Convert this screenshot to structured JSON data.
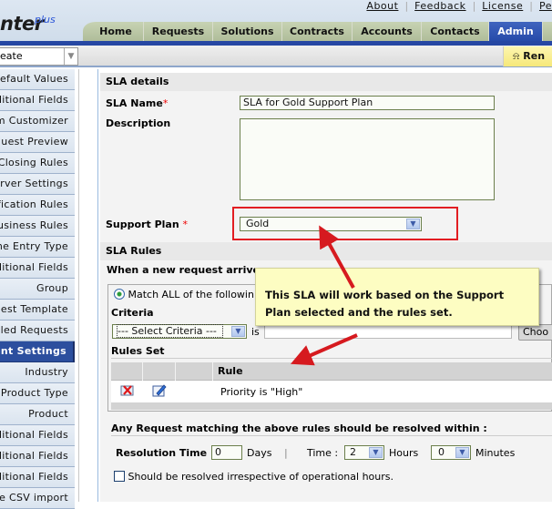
{
  "header": {
    "logo_text": "nter",
    "logo_suffix": "plus",
    "top_links": [
      "About",
      "Feedback",
      "License",
      "Pe"
    ],
    "tabs": [
      "Home",
      "Requests",
      "Solutions",
      "Contracts",
      "Accounts",
      "Contacts",
      "Admin"
    ],
    "active_tab": "Admin"
  },
  "subbar": {
    "quick_create_value": "eate",
    "reminder_label": "Ren"
  },
  "sidebar": {
    "items": [
      "Default Values",
      "Additional Fields",
      "Form Customizer",
      "Request Preview",
      "Closing Rules",
      "Server Settings",
      "Notification Rules",
      "Business Rules",
      "Time Entry Type",
      "Additional Fields",
      "Group",
      "Request Template",
      "Scheduled Requests",
      "Account Settings",
      "Industry",
      "Product Type",
      "Product",
      "Additional Fields",
      "Additional Fields",
      "Additional Fields",
      "Bulk CSV import"
    ],
    "visible_items": [
      "efault Values",
      "ditional Fields",
      "m Customizer",
      "quest Preview",
      "Closing Rules",
      "erver Settings",
      "fication Rules",
      "usiness Rules",
      "ne Entry Type",
      "ditional Fields",
      "Group",
      "est Template",
      "led Requests",
      "nt Settings",
      "Industry",
      "Product Type",
      "Product",
      "ditional Fields",
      "ditional Fields",
      "ditional Fields",
      "le CSV import"
    ],
    "active_index": 13
  },
  "form": {
    "sla_details_heading": "SLA details",
    "sla_name_label": "SLA Name",
    "sla_name_value": "SLA for Gold Support Plan",
    "description_label": "Description",
    "description_value": "",
    "support_plan_label": "Support Plan",
    "support_plan_value": "Gold",
    "required_mark": "*",
    "sla_rules_heading": "SLA Rules",
    "new_request_label": "When a new request arrives",
    "match_all_label": "Match ALL of the followin",
    "criteria_label": "Criteria",
    "criteria_select_value": "--- Select Criteria ---",
    "criteria_is": "is",
    "choose_button": "Choo",
    "rules_set_label": "Rules Set",
    "rules_table": {
      "header": "Rule",
      "rows": [
        {
          "rule": "Priority is \"High\""
        }
      ]
    },
    "resolve_within_heading": "Any Request matching the above rules should be resolved within :",
    "resolution_time_label": "Resolution Time :",
    "days_value": "0",
    "days_label": "Days",
    "separator": "|",
    "time_label": "Time :",
    "hours_value": "2",
    "hours_label": "Hours",
    "minutes_value": "0",
    "minutes_label": "Minutes",
    "operational_hours_label": "Should be resolved irrespective of operational hours.",
    "operational_hours_checked": false
  },
  "annotation": {
    "callout_text": "This SLA will work based on the Support Plan selected and the rules set.",
    "highlight_color": "#e21d22",
    "arrow_color": "#d61a1f"
  },
  "colors": {
    "admin_tab": "#2549a8",
    "tab_bg": "#aebb98",
    "active_sidebar": "#2c4f9e",
    "callout_bg": "#fdfdc2"
  }
}
